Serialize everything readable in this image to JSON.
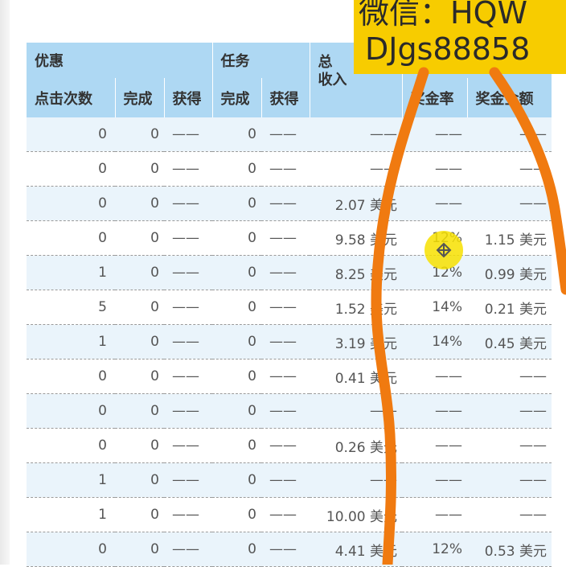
{
  "header": {
    "promo": "优惠",
    "task": "任务",
    "total_line1": "总",
    "total_line2": "收入",
    "clicks": "点击次数",
    "promo_done": "完成",
    "promo_earned": "获得",
    "task_done": "完成",
    "task_earned": "获得",
    "bonus_rate": "奖金率",
    "bonus_amount": "奖金金额"
  },
  "rows": [
    {
      "clicks": "0",
      "promo_done": "0",
      "promo_earned": "——",
      "task_done": "0",
      "task_earned": "——",
      "income": "——",
      "rate": "——",
      "amount": "——"
    },
    {
      "clicks": "0",
      "promo_done": "0",
      "promo_earned": "——",
      "task_done": "0",
      "task_earned": "——",
      "income": "——",
      "rate": "——",
      "amount": "——"
    },
    {
      "clicks": "0",
      "promo_done": "0",
      "promo_earned": "——",
      "task_done": "0",
      "task_earned": "——",
      "income": "2.07 美元",
      "rate": "——",
      "amount": "——"
    },
    {
      "clicks": "0",
      "promo_done": "0",
      "promo_earned": "——",
      "task_done": "0",
      "task_earned": "——",
      "income": "9.58 美元",
      "rate": "12%",
      "amount": "1.15 美元"
    },
    {
      "clicks": "1",
      "promo_done": "0",
      "promo_earned": "——",
      "task_done": "0",
      "task_earned": "——",
      "income": "8.25 美元",
      "rate": "12%",
      "amount": "0.99 美元"
    },
    {
      "clicks": "5",
      "promo_done": "0",
      "promo_earned": "——",
      "task_done": "0",
      "task_earned": "——",
      "income": "1.52 美元",
      "rate": "14%",
      "amount": "0.21 美元"
    },
    {
      "clicks": "1",
      "promo_done": "0",
      "promo_earned": "——",
      "task_done": "0",
      "task_earned": "——",
      "income": "3.19 美元",
      "rate": "14%",
      "amount": "0.45 美元"
    },
    {
      "clicks": "0",
      "promo_done": "0",
      "promo_earned": "——",
      "task_done": "0",
      "task_earned": "——",
      "income": "0.41 美元",
      "rate": "——",
      "amount": "——"
    },
    {
      "clicks": "0",
      "promo_done": "0",
      "promo_earned": "——",
      "task_done": "0",
      "task_earned": "——",
      "income": "——",
      "rate": "——",
      "amount": "——"
    },
    {
      "clicks": "0",
      "promo_done": "0",
      "promo_earned": "——",
      "task_done": "0",
      "task_earned": "——",
      "income": "0.26 美元",
      "rate": "——",
      "amount": "——"
    },
    {
      "clicks": "1",
      "promo_done": "0",
      "promo_earned": "——",
      "task_done": "0",
      "task_earned": "——",
      "income": "——",
      "rate": "——",
      "amount": "——"
    },
    {
      "clicks": "1",
      "promo_done": "0",
      "promo_earned": "——",
      "task_done": "0",
      "task_earned": "——",
      "income": "10.00 美元",
      "rate": "——",
      "amount": "——"
    },
    {
      "clicks": "0",
      "promo_done": "0",
      "promo_earned": "——",
      "task_done": "0",
      "task_earned": "——",
      "income": "4.41 美元",
      "rate": "12%",
      "amount": "0.53 美元"
    }
  ],
  "watermark": {
    "line1": "微信：HQW",
    "line2": "DJgs88858"
  },
  "colors": {
    "header_bg": "#aed8f3",
    "row_alt_bg": "#eaf4fb",
    "watermark_bg": "#f7cc00",
    "stroke": "#f07a10",
    "cursor_highlight": "#f7e000"
  },
  "icons": [
    "move-cursor-icon"
  ]
}
